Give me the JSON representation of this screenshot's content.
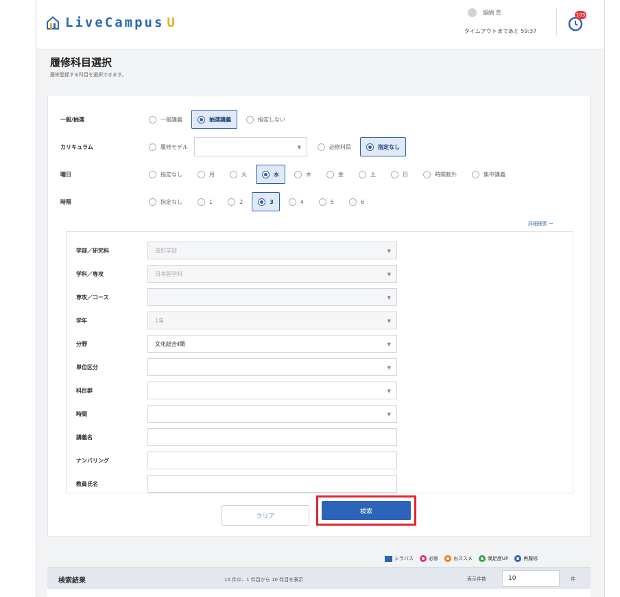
{
  "header": {
    "logo_text": "LiveCampus",
    "logo_u": "U",
    "user_name": "醍醐 豊",
    "timeout": "タイムアウトまであと 59:37",
    "notif_count": "103"
  },
  "page": {
    "title": "履修科目選択",
    "subtitle": "履修登録する科目を選択できます。"
  },
  "filters": {
    "general": {
      "label": "一般/抽選",
      "options": [
        "一般講義",
        "抽選講義",
        "指定しない"
      ],
      "selected_index": 1
    },
    "curriculum": {
      "label": "カリキュラム",
      "model_label": "履修モデル",
      "model_value": "",
      "options_after": [
        "必修科目",
        "指定なし"
      ],
      "selected_index": 1
    },
    "weekday": {
      "label": "曜日",
      "options": [
        "指定なし",
        "月",
        "火",
        "水",
        "木",
        "金",
        "土",
        "日",
        "時間割外",
        "集中講義"
      ],
      "selected_index": 3
    },
    "period": {
      "label": "時限",
      "options": [
        "指定なし",
        "1",
        "2",
        "3",
        "4",
        "5",
        "6"
      ],
      "selected_index": 3
    },
    "detail_link": "詳細検索 ー"
  },
  "detail": {
    "rows": [
      {
        "label": "学部／研究科",
        "value": "造形学部",
        "type": "select",
        "disabled": true
      },
      {
        "label": "学科／専攻",
        "value": "日本画学科",
        "type": "select",
        "disabled": true
      },
      {
        "label": "専攻／コース",
        "value": "",
        "type": "select",
        "disabled": true
      },
      {
        "label": "学年",
        "value": "1年",
        "type": "select",
        "disabled": true
      },
      {
        "label": "分野",
        "value": "文化総合Ⅱ類",
        "type": "select",
        "disabled": false
      },
      {
        "label": "単位区分",
        "value": "",
        "type": "select",
        "disabled": false
      },
      {
        "label": "科目群",
        "value": "",
        "type": "select",
        "disabled": false
      },
      {
        "label": "時間",
        "value": "",
        "type": "select",
        "disabled": false
      },
      {
        "label": "講義名",
        "value": "",
        "type": "text",
        "disabled": false
      },
      {
        "label": "ナンバリング",
        "value": "",
        "type": "text",
        "disabled": false
      },
      {
        "label": "教員氏名",
        "value": "",
        "type": "text",
        "disabled": false
      }
    ]
  },
  "buttons": {
    "clear": "クリア",
    "search": "検索"
  },
  "legend": [
    {
      "label": "シラバス",
      "icon": "syllabus-icon",
      "color": "#2b64b8"
    },
    {
      "label": "必修",
      "icon": "required-icon",
      "color": "#e0337e"
    },
    {
      "label": "おススメ",
      "icon": "recommend-icon",
      "color": "#ee7d1f"
    },
    {
      "label": "満足度UP",
      "icon": "satisfaction-up-icon",
      "color": "#2eab3f"
    },
    {
      "label": "再履修",
      "icon": "retake-icon",
      "color": "#2b64b8"
    }
  ],
  "results": {
    "title": "検索結果",
    "info": "10 件中、1 件目から 10 件目を表示",
    "count_label": "表示件数",
    "count_value": "10",
    "count_unit": "件"
  },
  "colors": {
    "accent": "#2b64b8",
    "highlight_border": "#e3232d",
    "logo_u": "#e8b21a"
  }
}
